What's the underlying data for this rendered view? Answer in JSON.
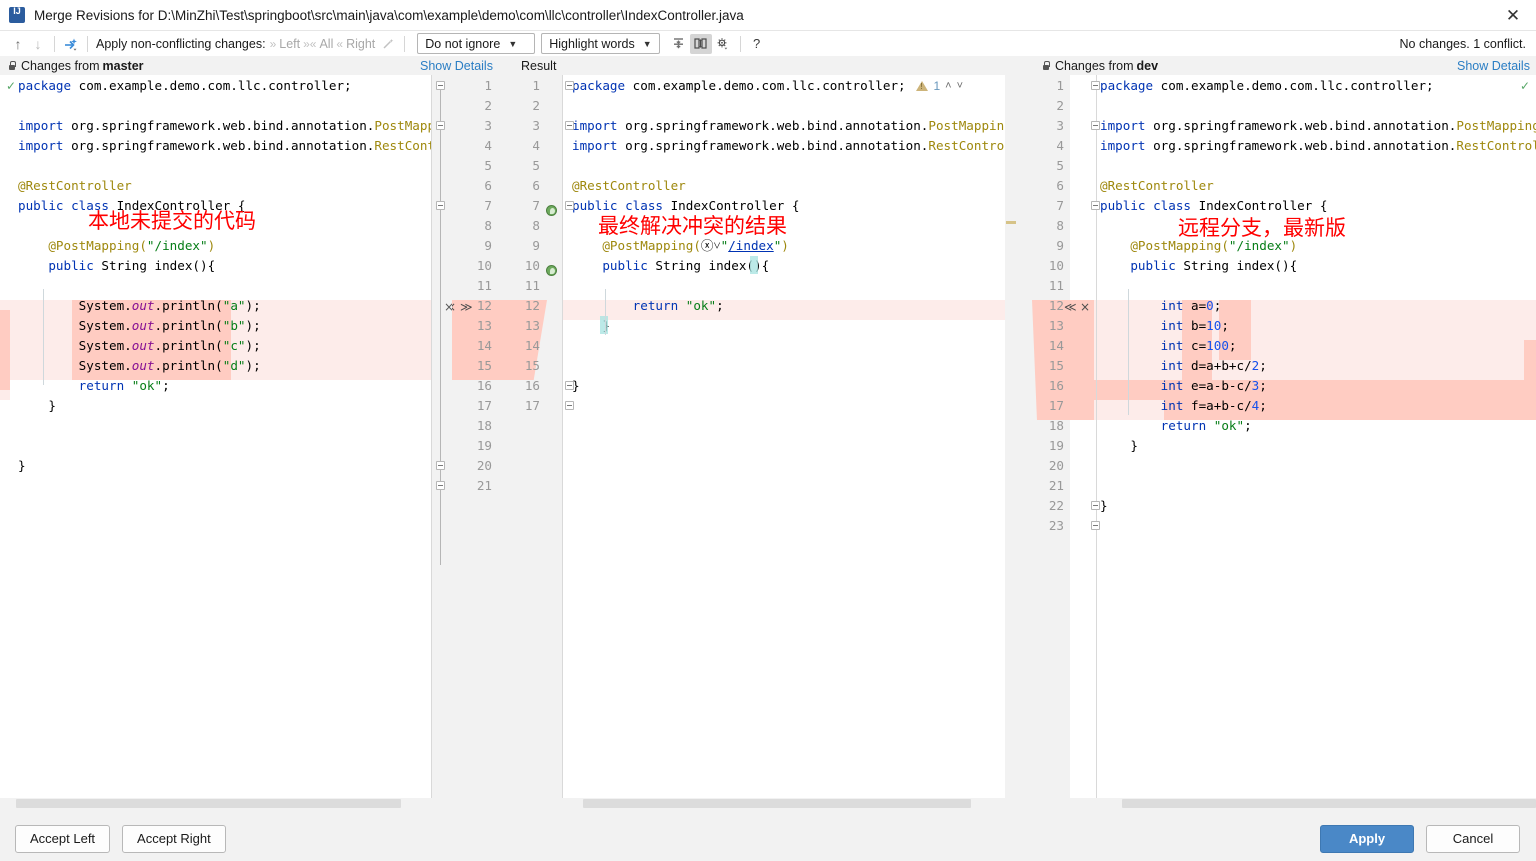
{
  "window": {
    "title": "Merge Revisions for D:\\MinZhi\\Test\\springboot\\src\\main\\java\\com\\example\\demo\\com\\llc\\controller\\IndexController.java",
    "close_label": "✕",
    "app_icon": "intellij-idea-icon"
  },
  "toolbar": {
    "prev_diff_icon": "arrow-up-icon",
    "next_diff_icon": "arrow-down-icon",
    "magic_resolve_icon": "apply-all-non-conflicting-icon",
    "apply_label": "Apply non-conflicting changes:",
    "left_label": "Left",
    "all_label": "All",
    "right_label": "Right",
    "wand_icon": "magic-wand-icon",
    "ignore_policy": "Do not ignore",
    "highlight_policy": "Highlight words",
    "collapse_icon": "collapse-unchanged-icon",
    "columns_icon": "side-by-side-viewer-icon",
    "settings_icon": "gear-icon",
    "help_icon": "?",
    "status": "No changes. 1 conflict."
  },
  "panels": {
    "left": {
      "header": "Changes from ",
      "branch": "master",
      "lock_icon": "lock-icon",
      "show_details": "Show Details"
    },
    "center": {
      "header": "Result"
    },
    "right": {
      "header": "Changes from ",
      "branch": "dev",
      "lock_icon": "lock-icon",
      "show_details": "Show Details"
    }
  },
  "inspection": {
    "warning_icon": "warning-triangle-icon",
    "count": "1",
    "up_icon": "˄",
    "down_icon": "˅"
  },
  "annotations": {
    "left": "本地未提交的代码",
    "center": "最终解决冲突的结果",
    "right": "远程分支，最新版"
  },
  "gutter_actions": {
    "left_accept": "×",
    "left_push": "≫",
    "right_push": "≪",
    "right_accept": "×"
  },
  "left_code": [
    {
      "n": 1,
      "tokens": [
        {
          "t": "package",
          "c": "kw"
        },
        {
          "t": " com.example.demo.com.llc.controller;",
          "c": "plain"
        }
      ]
    },
    {
      "n": 2,
      "tokens": []
    },
    {
      "n": 3,
      "tokens": [
        {
          "t": "import",
          "c": "kw"
        },
        {
          "t": " org.springframework.web.bind.annotation.",
          "c": "plain"
        },
        {
          "t": "PostMapping",
          "c": "ann"
        },
        {
          "t": ";",
          "c": "plain"
        }
      ]
    },
    {
      "n": 4,
      "tokens": [
        {
          "t": "import",
          "c": "kw"
        },
        {
          "t": " org.springframework.web.bind.annotation.",
          "c": "plain"
        },
        {
          "t": "RestControlle",
          "c": "ann"
        }
      ]
    },
    {
      "n": 5,
      "tokens": []
    },
    {
      "n": 6,
      "tokens": [
        {
          "t": "@RestController",
          "c": "ann"
        }
      ]
    },
    {
      "n": 7,
      "tokens": [
        {
          "t": "public",
          "c": "kw"
        },
        {
          "t": " ",
          "c": "plain"
        },
        {
          "t": "class",
          "c": "kw"
        },
        {
          "t": " IndexController {",
          "c": "plain"
        }
      ]
    },
    {
      "n": 8,
      "tokens": []
    },
    {
      "n": 9,
      "tokens": [
        {
          "t": "    @PostMapping(",
          "c": "ann"
        },
        {
          "t": "\"/index\"",
          "c": "str"
        },
        {
          "t": ")",
          "c": "ann"
        }
      ]
    },
    {
      "n": 10,
      "tokens": [
        {
          "t": "    ",
          "c": "plain"
        },
        {
          "t": "public",
          "c": "kw"
        },
        {
          "t": " String index(){",
          "c": "plain"
        }
      ]
    },
    {
      "n": 11,
      "tokens": []
    },
    {
      "n": 12,
      "tokens": [
        {
          "t": "        System.",
          "c": "plain"
        },
        {
          "t": "out",
          "c": "fld"
        },
        {
          "t": ".println(",
          "c": "plain"
        },
        {
          "t": "\"a\"",
          "c": "str"
        },
        {
          "t": ");",
          "c": "plain"
        }
      ]
    },
    {
      "n": 13,
      "tokens": [
        {
          "t": "        System.",
          "c": "plain"
        },
        {
          "t": "out",
          "c": "fld"
        },
        {
          "t": ".println(",
          "c": "plain"
        },
        {
          "t": "\"b\"",
          "c": "str"
        },
        {
          "t": ");",
          "c": "plain"
        }
      ]
    },
    {
      "n": 14,
      "tokens": [
        {
          "t": "        System.",
          "c": "plain"
        },
        {
          "t": "out",
          "c": "fld"
        },
        {
          "t": ".println(",
          "c": "plain"
        },
        {
          "t": "\"c\"",
          "c": "str"
        },
        {
          "t": ");",
          "c": "plain"
        }
      ]
    },
    {
      "n": 15,
      "tokens": [
        {
          "t": "        System.",
          "c": "plain"
        },
        {
          "t": "out",
          "c": "fld"
        },
        {
          "t": ".println(",
          "c": "plain"
        },
        {
          "t": "\"d\"",
          "c": "str"
        },
        {
          "t": ");",
          "c": "plain"
        }
      ]
    },
    {
      "n": 16,
      "tokens": [
        {
          "t": "        ",
          "c": "plain"
        },
        {
          "t": "return",
          "c": "kw"
        },
        {
          "t": " ",
          "c": "plain"
        },
        {
          "t": "\"ok\"",
          "c": "str"
        },
        {
          "t": ";",
          "c": "plain"
        }
      ]
    },
    {
      "n": 17,
      "tokens": [
        {
          "t": "    }",
          "c": "plain"
        }
      ]
    },
    {
      "n": 18,
      "tokens": []
    },
    {
      "n": 19,
      "tokens": []
    },
    {
      "n": 20,
      "tokens": [
        {
          "t": "}",
          "c": "plain"
        }
      ]
    },
    {
      "n": 21,
      "tokens": []
    }
  ],
  "center_code": [
    {
      "n": 1,
      "tokens": [
        {
          "t": "package",
          "c": "kw"
        },
        {
          "t": " com.example.demo.com.llc.controller;",
          "c": "plain"
        }
      ]
    },
    {
      "n": 2,
      "tokens": []
    },
    {
      "n": 3,
      "tokens": [
        {
          "t": "import",
          "c": "kw"
        },
        {
          "t": " org.springframework.web.bind.annotation.",
          "c": "plain"
        },
        {
          "t": "PostMapping",
          "c": "ann"
        },
        {
          "t": ";",
          "c": "plain"
        }
      ]
    },
    {
      "n": 4,
      "tokens": [
        {
          "t": "import",
          "c": "kw"
        },
        {
          "t": " org.springframework.web.bind.annotation.",
          "c": "plain"
        },
        {
          "t": "RestController",
          "c": "ann"
        },
        {
          "t": ";",
          "c": "plain"
        }
      ]
    },
    {
      "n": 5,
      "tokens": []
    },
    {
      "n": 6,
      "tokens": [
        {
          "t": "@RestController",
          "c": "ann"
        }
      ]
    },
    {
      "n": 7,
      "tokens": [
        {
          "t": "public",
          "c": "kw"
        },
        {
          "t": " ",
          "c": "plain"
        },
        {
          "t": "class",
          "c": "kw"
        },
        {
          "t": " IndexController {",
          "c": "plain"
        }
      ]
    },
    {
      "n": 8,
      "tokens": []
    },
    {
      "n": 9,
      "tokens": [
        {
          "t": "    @PostMapping(",
          "c": "ann"
        },
        {
          "t": "ⓧ˅",
          "c": "plain"
        },
        {
          "t": "\"",
          "c": "str"
        },
        {
          "t": "/index",
          "c": "link"
        },
        {
          "t": "\"",
          "c": "str"
        },
        {
          "t": ")",
          "c": "ann"
        }
      ]
    },
    {
      "n": 10,
      "tokens": [
        {
          "t": "    ",
          "c": "plain"
        },
        {
          "t": "public",
          "c": "kw"
        },
        {
          "t": " String index(){",
          "c": "plain"
        }
      ]
    },
    {
      "n": 11,
      "tokens": []
    },
    {
      "n": 12,
      "tokens": [
        {
          "t": "        ",
          "c": "plain"
        },
        {
          "t": "return",
          "c": "kw"
        },
        {
          "t": " ",
          "c": "plain"
        },
        {
          "t": "\"ok\"",
          "c": "str"
        },
        {
          "t": ";",
          "c": "plain"
        }
      ]
    },
    {
      "n": 13,
      "tokens": [
        {
          "t": "    }",
          "c": "plain"
        }
      ]
    },
    {
      "n": 14,
      "tokens": []
    },
    {
      "n": 15,
      "tokens": []
    },
    {
      "n": 16,
      "tokens": [
        {
          "t": "}",
          "c": "plain"
        }
      ]
    },
    {
      "n": 17,
      "tokens": []
    }
  ],
  "right_code": [
    {
      "n": 1,
      "tokens": [
        {
          "t": "package",
          "c": "kw"
        },
        {
          "t": " com.example.demo.com.llc.controller;",
          "c": "plain"
        }
      ]
    },
    {
      "n": 2,
      "tokens": []
    },
    {
      "n": 3,
      "tokens": [
        {
          "t": "import",
          "c": "kw"
        },
        {
          "t": " org.springframework.web.bind.annotation.",
          "c": "plain"
        },
        {
          "t": "PostMapping",
          "c": "ann"
        },
        {
          "t": ";",
          "c": "plain"
        }
      ]
    },
    {
      "n": 4,
      "tokens": [
        {
          "t": "import",
          "c": "kw"
        },
        {
          "t": " org.springframework.web.bind.annotation.",
          "c": "plain"
        },
        {
          "t": "RestController",
          "c": "ann"
        },
        {
          "t": ";",
          "c": "plain"
        }
      ]
    },
    {
      "n": 5,
      "tokens": []
    },
    {
      "n": 6,
      "tokens": [
        {
          "t": "@RestController",
          "c": "ann"
        }
      ]
    },
    {
      "n": 7,
      "tokens": [
        {
          "t": "public",
          "c": "kw"
        },
        {
          "t": " ",
          "c": "plain"
        },
        {
          "t": "class",
          "c": "kw"
        },
        {
          "t": " IndexController {",
          "c": "plain"
        }
      ]
    },
    {
      "n": 8,
      "tokens": []
    },
    {
      "n": 9,
      "tokens": [
        {
          "t": "    @PostMapping(",
          "c": "ann"
        },
        {
          "t": "\"/index\"",
          "c": "str"
        },
        {
          "t": ")",
          "c": "ann"
        }
      ]
    },
    {
      "n": 10,
      "tokens": [
        {
          "t": "    ",
          "c": "plain"
        },
        {
          "t": "public",
          "c": "kw"
        },
        {
          "t": " String index(){",
          "c": "plain"
        }
      ]
    },
    {
      "n": 11,
      "tokens": []
    },
    {
      "n": 12,
      "tokens": [
        {
          "t": "        ",
          "c": "plain"
        },
        {
          "t": "int",
          "c": "kw"
        },
        {
          "t": " a=",
          "c": "plain"
        },
        {
          "t": "0",
          "c": "num"
        },
        {
          "t": ";",
          "c": "plain"
        }
      ]
    },
    {
      "n": 13,
      "tokens": [
        {
          "t": "        ",
          "c": "plain"
        },
        {
          "t": "int",
          "c": "kw"
        },
        {
          "t": " b=",
          "c": "plain"
        },
        {
          "t": "10",
          "c": "num"
        },
        {
          "t": ";",
          "c": "plain"
        }
      ]
    },
    {
      "n": 14,
      "tokens": [
        {
          "t": "        ",
          "c": "plain"
        },
        {
          "t": "int",
          "c": "kw"
        },
        {
          "t": " c=",
          "c": "plain"
        },
        {
          "t": "100",
          "c": "num"
        },
        {
          "t": ";",
          "c": "plain"
        }
      ]
    },
    {
      "n": 15,
      "tokens": [
        {
          "t": "        ",
          "c": "plain"
        },
        {
          "t": "int",
          "c": "kw"
        },
        {
          "t": " d=a+b+c/",
          "c": "plain"
        },
        {
          "t": "2",
          "c": "num"
        },
        {
          "t": ";",
          "c": "plain"
        }
      ]
    },
    {
      "n": 16,
      "tokens": [
        {
          "t": "        ",
          "c": "plain"
        },
        {
          "t": "int",
          "c": "kw"
        },
        {
          "t": " e=a-b-c/",
          "c": "plain"
        },
        {
          "t": "3",
          "c": "num"
        },
        {
          "t": ";",
          "c": "plain"
        }
      ]
    },
    {
      "n": 17,
      "tokens": [
        {
          "t": "        ",
          "c": "plain"
        },
        {
          "t": "int",
          "c": "kw"
        },
        {
          "t": " f=a+b-c/",
          "c": "plain"
        },
        {
          "t": "4",
          "c": "num"
        },
        {
          "t": ";",
          "c": "plain"
        }
      ]
    },
    {
      "n": 18,
      "tokens": [
        {
          "t": "        ",
          "c": "plain"
        },
        {
          "t": "return",
          "c": "kw"
        },
        {
          "t": " ",
          "c": "plain"
        },
        {
          "t": "\"ok\"",
          "c": "str"
        },
        {
          "t": ";",
          "c": "plain"
        }
      ]
    },
    {
      "n": 19,
      "tokens": [
        {
          "t": "    }",
          "c": "plain"
        }
      ]
    },
    {
      "n": 20,
      "tokens": []
    },
    {
      "n": 21,
      "tokens": []
    },
    {
      "n": 22,
      "tokens": [
        {
          "t": "}",
          "c": "plain"
        }
      ]
    },
    {
      "n": 23,
      "tokens": []
    }
  ],
  "buttons": {
    "accept_left": "Accept Left",
    "accept_right": "Accept Right",
    "apply": "Apply",
    "cancel": "Cancel"
  },
  "colors": {
    "accent": "#4a88c7",
    "link": "#2b7ec4",
    "conflict_soft": "#fdecea",
    "conflict_strong": "#ffccc2",
    "annotation_red": "#ff0000"
  }
}
